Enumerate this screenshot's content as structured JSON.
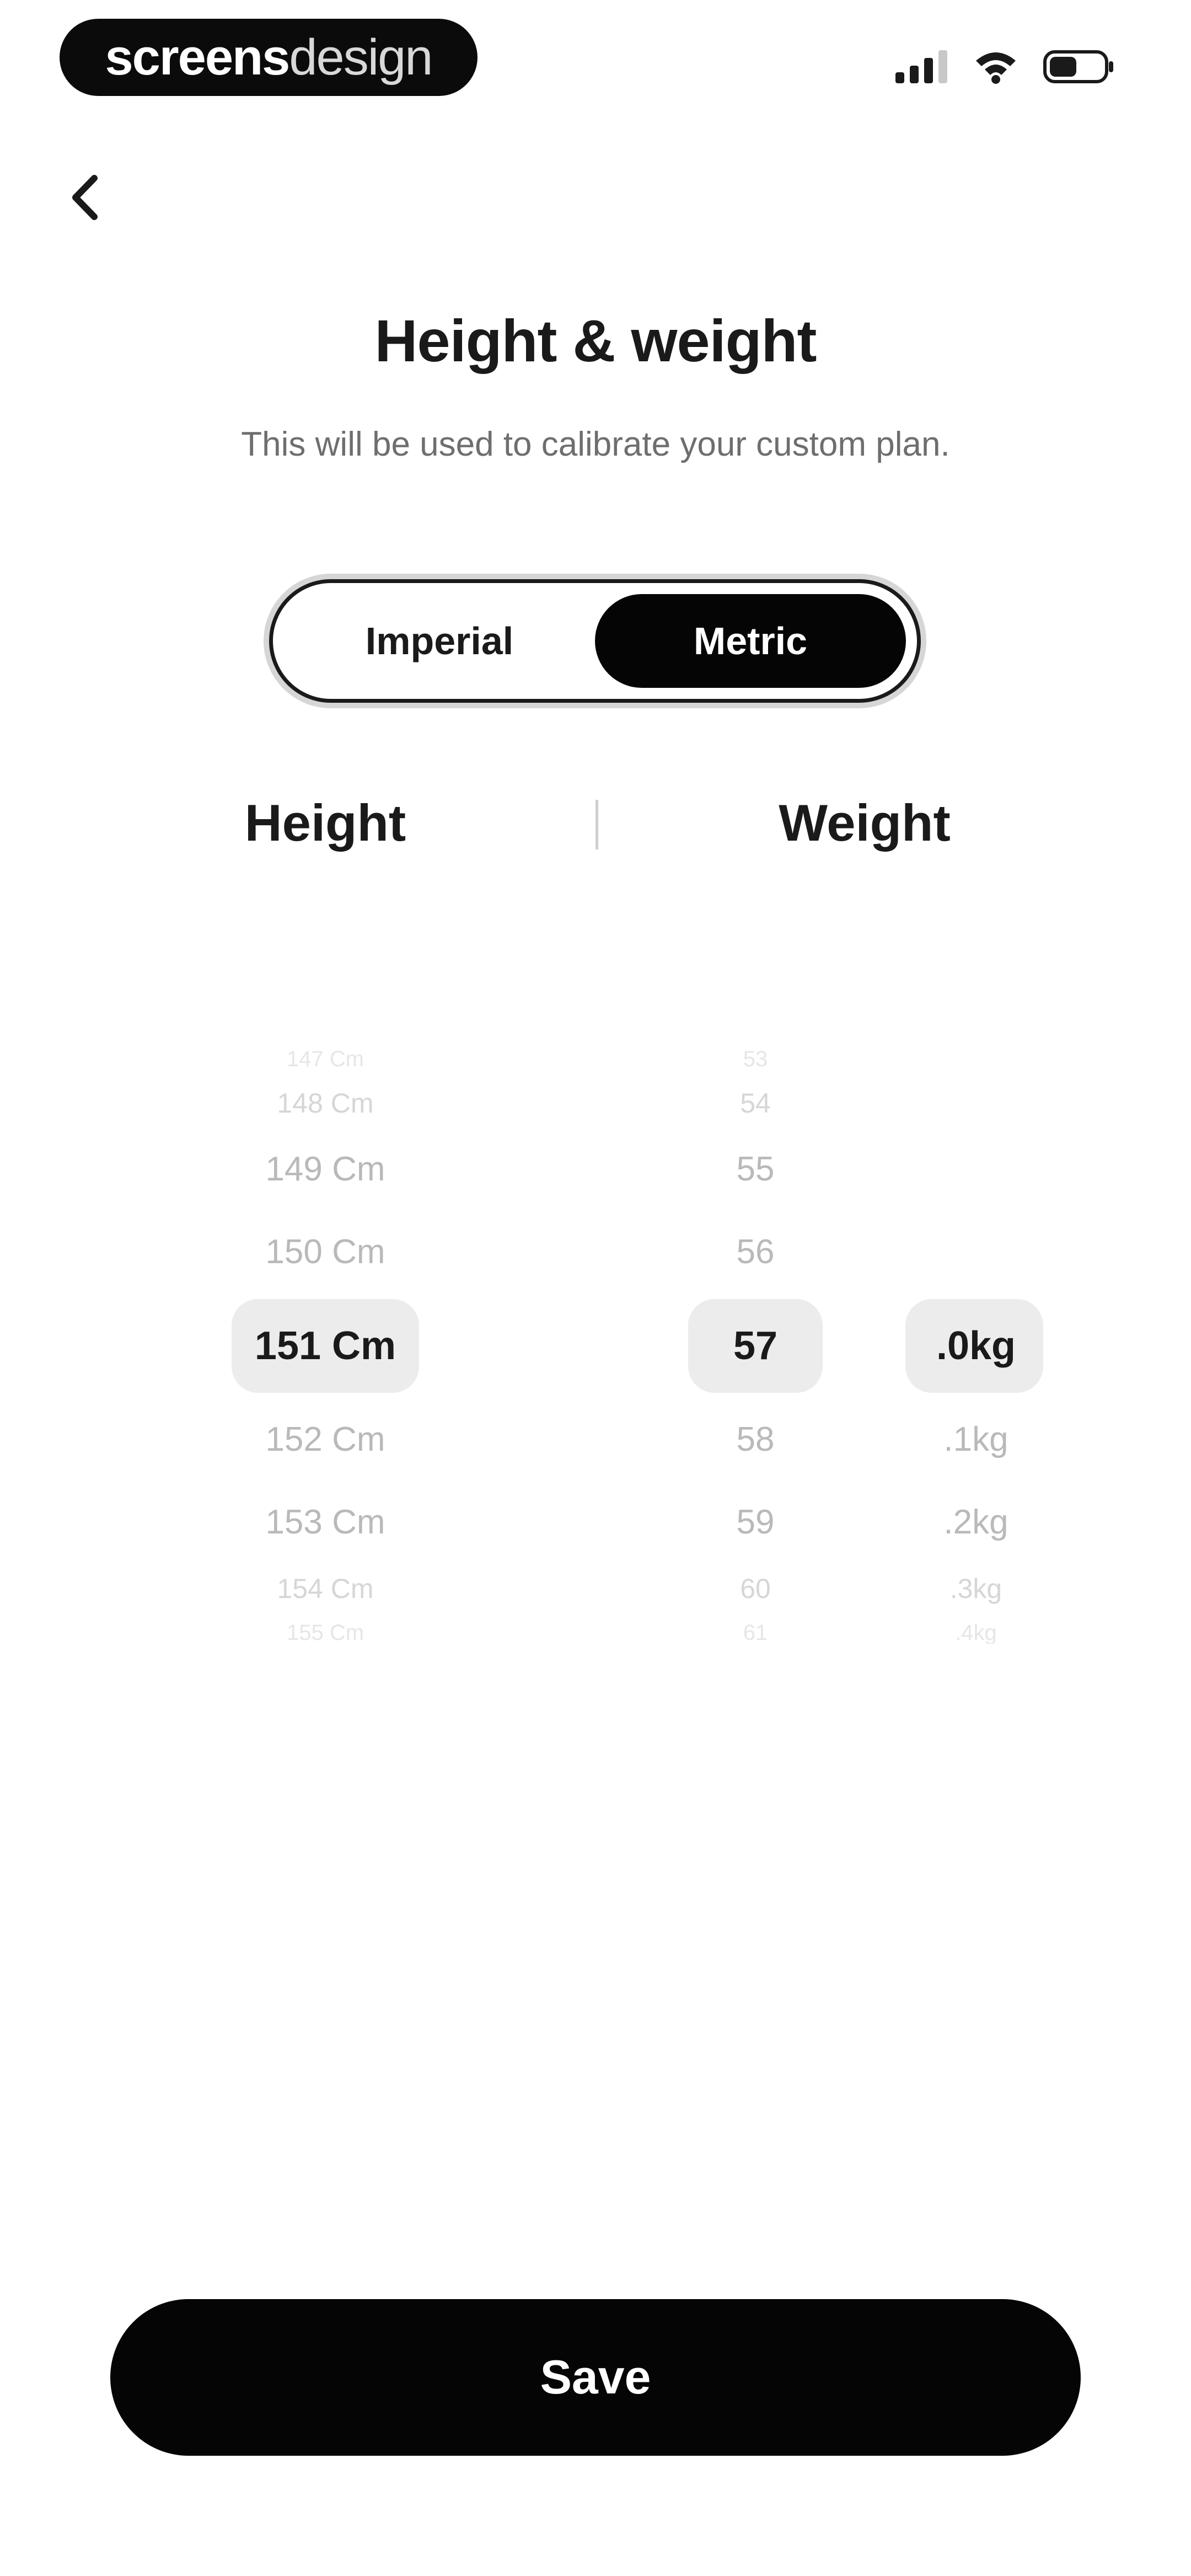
{
  "status_bar": {
    "brand_bold": "screens",
    "brand_light": "design",
    "icons": [
      "cellular-signal-icon",
      "wifi-icon",
      "battery-icon"
    ]
  },
  "header": {
    "back_icon": "chevron-left-icon",
    "title": "Height & weight",
    "subtitle": "This will be used to calibrate your custom plan."
  },
  "unit_toggle": {
    "options": [
      {
        "label": "Imperial",
        "active": false
      },
      {
        "label": "Metric",
        "active": true
      }
    ]
  },
  "columns": {
    "height_label": "Height",
    "weight_label": "Weight"
  },
  "pickers": {
    "height": {
      "items": [
        "147 Cm",
        "148 Cm",
        "149 Cm",
        "150 Cm",
        "151 Cm",
        "152 Cm",
        "153 Cm",
        "154 Cm",
        "155 Cm"
      ],
      "selected_index": 4
    },
    "weight_kg": {
      "items": [
        "53",
        "54",
        "55",
        "56",
        "57",
        "58",
        "59",
        "60",
        "61"
      ],
      "selected_index": 4
    },
    "weight_decimal": {
      "items": [
        ".0kg",
        ".1kg",
        ".2kg",
        ".3kg",
        ".4kg"
      ],
      "selected_index": 0
    }
  },
  "save_button": {
    "label": "Save"
  },
  "colors": {
    "primary": "#050505",
    "background": "#ffffff",
    "highlight": "#ececec",
    "muted_text": "#b9b9b9"
  }
}
